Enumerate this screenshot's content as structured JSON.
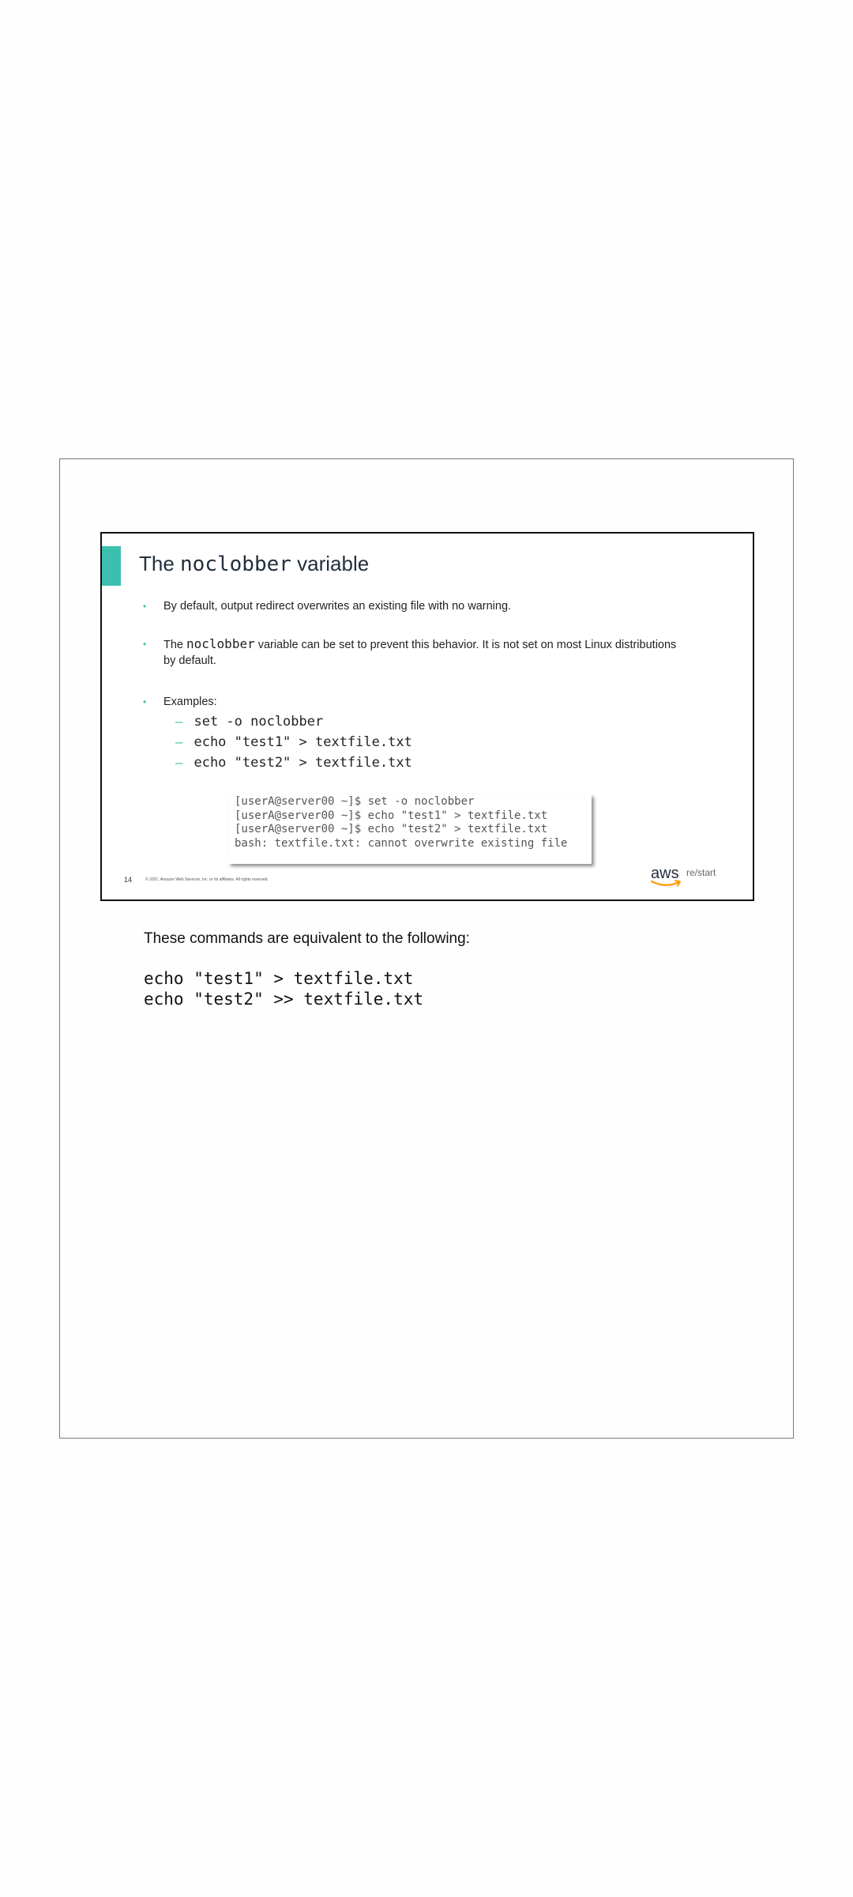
{
  "slide": {
    "title_prefix": "The ",
    "title_code": "noclobber",
    "title_suffix": " variable",
    "bullets": [
      {
        "text": "By default, output redirect overwrites an existing file with no warning."
      },
      {
        "prefix": "The ",
        "code": "noclobber",
        "suffix": " variable can be set to prevent this behavior. It is not set on most Linux distributions by default."
      },
      {
        "text": "Examples:"
      }
    ],
    "examples": [
      "set -o noclobber",
      "echo \"test1\" > textfile.txt",
      "echo \"test2\" > textfile.txt"
    ],
    "terminal_lines": [
      "[userA@server00 ~]$ set -o noclobber",
      "[userA@server00 ~]$ echo \"test1\" > textfile.txt",
      "[userA@server00 ~]$ echo \"test2\" > textfile.txt",
      "bash: textfile.txt: cannot overwrite existing file"
    ],
    "slide_number": "14",
    "copyright": "© 2021, Amazon Web Services, Inc. or its affiliates. All rights reserved.",
    "logo": {
      "brand": "aws",
      "product": "re/start",
      "smile_color": "#ff9900"
    },
    "accent_color": "#3cbfae"
  },
  "notes": {
    "intro": "These commands are equivalent to the following:",
    "code_lines": [
      "echo \"test1\" > textfile.txt",
      "echo \"test2\" >> textfile.txt"
    ]
  }
}
